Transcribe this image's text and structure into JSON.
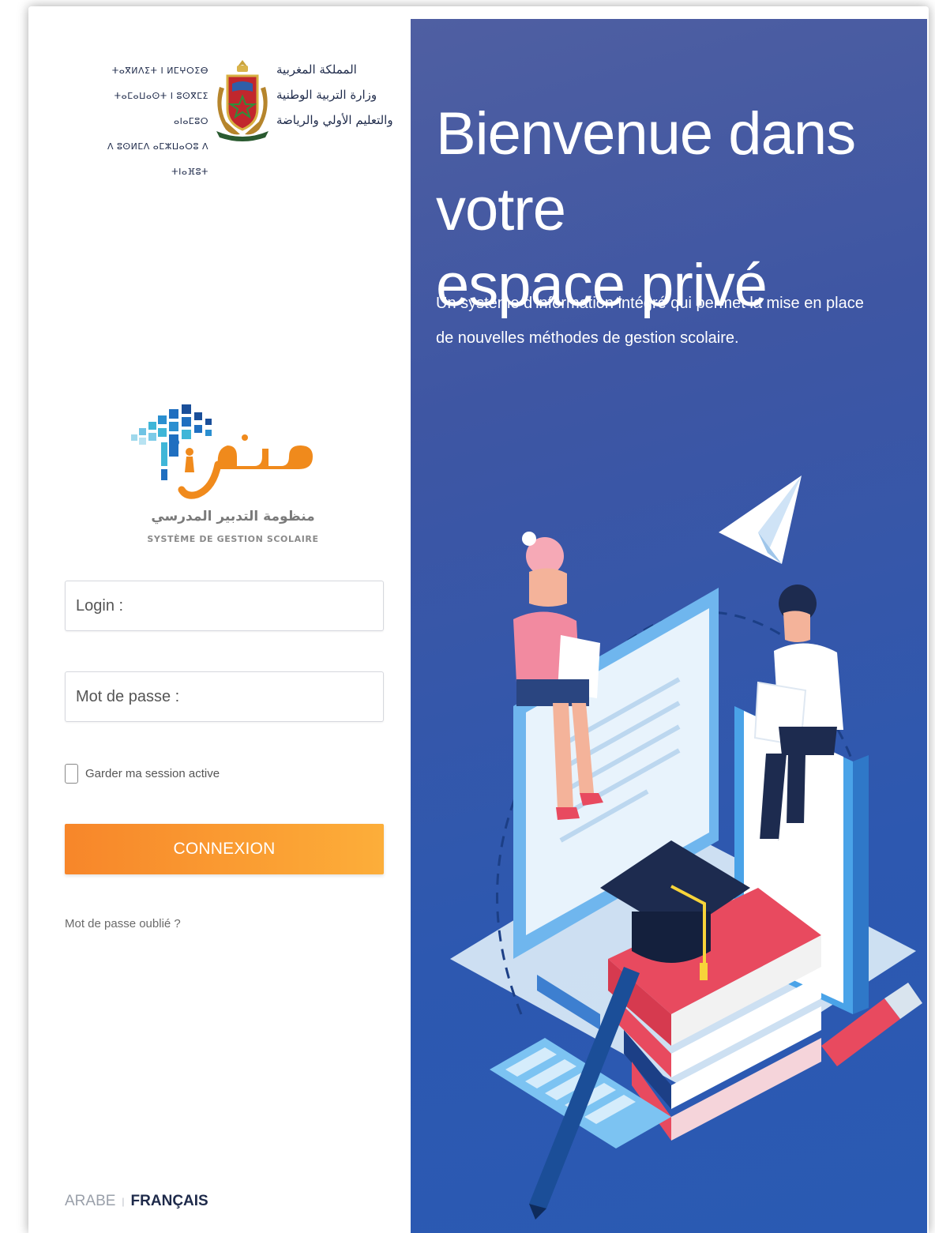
{
  "ministry": {
    "tifinagh_lines": [
      "ⵜⴰⴳⵍⴷⵉⵜ ⵏ ⵍⵎⵖⵔⵉⴱ",
      "ⵜⴰⵎⴰⵡⴰⵙⵜ ⵏ ⵓⵙⴳⵎⵉ ⴰⵏⴰⵎⵓⵔ",
      "ⴷ ⵓⵙⵍⵎⴷ ⴰⵎⵣⵡⴰⵔⵓ ⴷ ⵜⵏⴰⴼⵓⵜ"
    ],
    "arabic_lines": [
      "المملكة المغربية",
      "وزارة التربية الوطنية",
      "والتعليم الأولي والرياضة"
    ]
  },
  "logo": {
    "arabic_word": "مسار",
    "arabic_subtitle": "منظومة التدبير المدرسي",
    "french_subtitle": "SYSTÈME DE GESTION SCOLAIRE",
    "colors": {
      "orange": "#f08a1c",
      "blue": "#1f6fc0",
      "teal": "#3fb6d8"
    }
  },
  "form": {
    "login_placeholder": "Login :",
    "password_placeholder": "Mot de passe :",
    "remember_label": "Garder ma session active",
    "remember_checked": false,
    "submit_label": "CONNEXION",
    "forgot_label": "Mot de passe oublié ?"
  },
  "language": {
    "arabic_label": "ARABE",
    "separator": "|",
    "french_label": "FRANÇAIS",
    "active": "FRANÇAIS"
  },
  "hero": {
    "title_line1": "Bienvenue dans votre",
    "title_line2": "espace privé",
    "description": "Un système d'information intégré qui permet la mise en place de nouvelles méthodes de gestion scolaire."
  },
  "colors": {
    "accent_orange": "#f7862a",
    "hero_blue": "#3e56a3",
    "text_dark": "#1e2a4a"
  }
}
